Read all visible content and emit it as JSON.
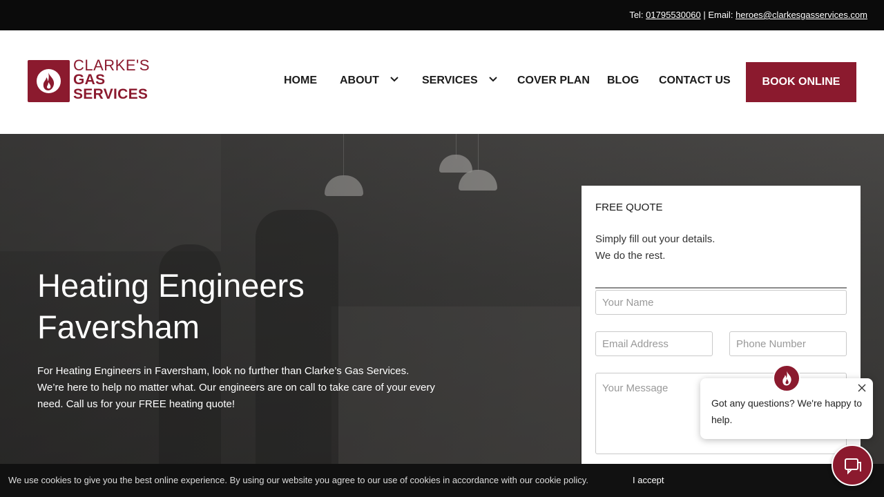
{
  "topbar": {
    "tel_label": "Tel:",
    "tel_number": "01795530060",
    "separator": "| Email:",
    "email": "heroes@clarkesgasservices.com"
  },
  "logo": {
    "line1": "CLARKE'S",
    "line2": "GAS",
    "line3": "SERVICES",
    "icon": "flame-icon",
    "brand_color": "#8b1a2e"
  },
  "nav": {
    "items": [
      {
        "label": "HOME",
        "has_dropdown": false
      },
      {
        "label": "ABOUT",
        "has_dropdown": true
      },
      {
        "label": "SERVICES",
        "has_dropdown": true
      },
      {
        "label": "COVER PLAN",
        "has_dropdown": false
      },
      {
        "label": "BLOG",
        "has_dropdown": false
      },
      {
        "label": "CONTACT US",
        "has_dropdown": false
      }
    ],
    "book_label": "BOOK ONLINE"
  },
  "hero": {
    "title_line1": "Heating Engineers",
    "title_line2": "Faversham",
    "text": "For Heating Engineers in Faversham, look no further than Clarke’s Gas Services. We’re here to help no matter what. Our engineers are on call to take care of your every need. Call us for your FREE heating quote!"
  },
  "quote_form": {
    "title": "FREE QUOTE",
    "subtitle_line1": "Simply fill out your details.",
    "subtitle_line2": "We do the rest.",
    "name_placeholder": "Your Name",
    "email_placeholder": "Email Address",
    "phone_placeholder": "Phone Number",
    "message_placeholder": "Your Message"
  },
  "chat": {
    "message": "Got any questions? We're happy to help.",
    "avatar_icon": "flame-icon",
    "launcher_icon": "chat-bubble-icon"
  },
  "cookie": {
    "text": "We use cookies to give you the best online experience. By using our website you agree to our use of cookies in accordance with our cookie policy.",
    "accept_label": "I accept"
  }
}
